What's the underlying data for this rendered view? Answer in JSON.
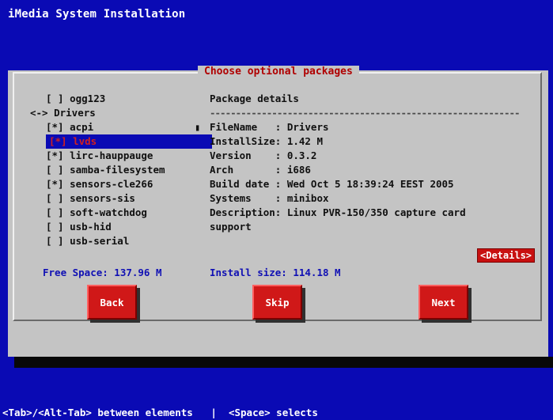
{
  "window": {
    "title": "iMedia System Installation"
  },
  "dialog": {
    "title": "Choose optional packages",
    "packages": [
      {
        "label": "[ ] ogg123",
        "level": 1,
        "selected": false
      },
      {
        "label": "<-> Drivers",
        "level": 0,
        "selected": false
      },
      {
        "label": "[*] acpi",
        "level": 1,
        "selected": false
      },
      {
        "label": "[*] lvds",
        "level": 1,
        "selected": true
      },
      {
        "label": "[*] lirc-hauppauge",
        "level": 1,
        "selected": false
      },
      {
        "label": "[ ] samba-filesystem",
        "level": 1,
        "selected": false
      },
      {
        "label": "[*] sensors-cle266",
        "level": 1,
        "selected": false
      },
      {
        "label": "[ ] sensors-sis",
        "level": 1,
        "selected": false
      },
      {
        "label": "[ ] soft-watchdog",
        "level": 1,
        "selected": false
      },
      {
        "label": "[ ] usb-hid",
        "level": 1,
        "selected": false
      },
      {
        "label": "[ ] usb-serial",
        "level": 1,
        "selected": false
      }
    ],
    "scroll_marker": "▮",
    "details": {
      "heading": "Package details",
      "separator": "------------------------------------------------------------",
      "lines": [
        "FileName   : Drivers",
        "InstallSize: 1.42 M",
        "Version    : 0.3.2",
        "Arch       : i686",
        "Build date : Wed Oct 5 18:39:24 EEST 2005",
        "Systems    : minibox",
        "Description: Linux PVR-150/350 capture card",
        "support"
      ],
      "details_button": "<Details>"
    },
    "free_space": "Free Space: 137.96 M",
    "install_size": "Install size: 114.18 M",
    "buttons": {
      "back": "Back",
      "skip": "Skip",
      "next": "Next"
    }
  },
  "status_bar": {
    "text": "<Tab>/<Alt-Tab> between elements   |  <Space> selects"
  },
  "colors": {
    "background": "#0a0ab4",
    "dialog": "#c4c4c4",
    "accent_red": "#d01818",
    "title_red": "#b00000",
    "label_blue": "#1010b4"
  }
}
